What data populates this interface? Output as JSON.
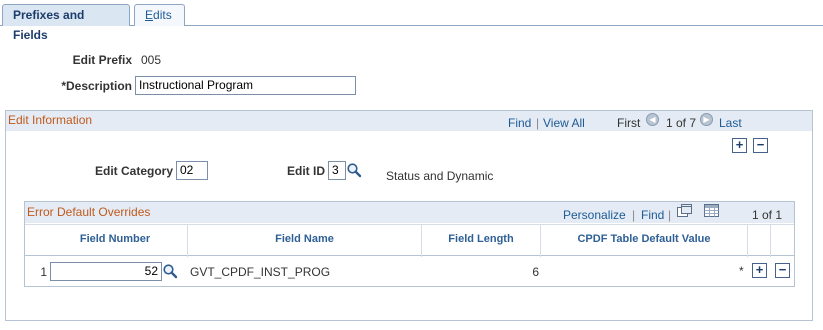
{
  "tabs": [
    {
      "label": "Prefixes and Fields"
    },
    {
      "label": "Edits",
      "mnemonic": "E",
      "rest": "dits"
    }
  ],
  "header": {
    "edit_prefix_label": "Edit Prefix",
    "edit_prefix_value": "005",
    "description_label": "*Description",
    "description_value": "Instructional Program"
  },
  "edit_info": {
    "title": "Edit Information",
    "find": "Find",
    "sep": "|",
    "view_all": "View All",
    "first": "First",
    "count": "1 of 7",
    "last": "Last",
    "edit_category_label": "Edit Category",
    "edit_category_value": "02",
    "edit_id_label": "Edit ID",
    "edit_id_value": "3",
    "edit_id_desc": "Status and Dynamic",
    "add": "+",
    "remove": "−"
  },
  "grid": {
    "title": "Error Default Overrides",
    "personalize": "Personalize",
    "sep": "|",
    "find": "Find",
    "sep2": "|",
    "count": "1 of 1",
    "columns": [
      "Field Number",
      "Field Name",
      "Field Length",
      "CPDF Table Default Value"
    ],
    "rows": [
      {
        "num": "1",
        "field_number": "52",
        "field_name": "GVT_CPDF_INST_PROG",
        "field_length": "6",
        "default_value": "",
        "marker": "*"
      }
    ],
    "add": "+",
    "remove": "−"
  }
}
